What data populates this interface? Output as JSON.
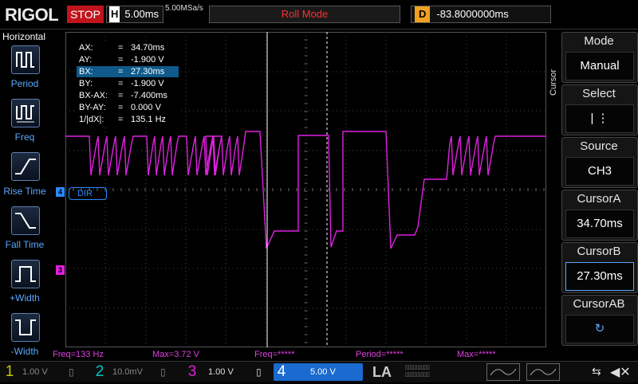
{
  "top_bar": {
    "brand": "RIGOL",
    "run_state": "STOP",
    "timebase_key": "H",
    "timebase": "5.00ms",
    "sample_rate": "5.00MSa/s",
    "mode": "Roll Mode",
    "delay_key": "D",
    "delay": "-83.8000000ms"
  },
  "left_panel": {
    "title": "Horizontal",
    "items": [
      {
        "label": "Period",
        "icon": "period-icon"
      },
      {
        "label": "Freq",
        "icon": "frequency-icon"
      },
      {
        "label": "Rise Time",
        "icon": "rise-time-icon"
      },
      {
        "label": "Fall Time",
        "icon": "fall-time-icon"
      },
      {
        "label": "+Width",
        "icon": "positive-width-icon"
      },
      {
        "label": "-Width",
        "icon": "negative-width-icon"
      }
    ]
  },
  "cursor_readout": {
    "rows": [
      {
        "key": "AX:",
        "value": "34.70ms"
      },
      {
        "key": "AY:",
        "value": "-1.900 V"
      },
      {
        "key": "BX:",
        "value": "27.30ms"
      },
      {
        "key": "BY:",
        "value": "-1.900 V"
      },
      {
        "key": "BX-AX:",
        "value": "-7.400ms"
      },
      {
        "key": "BY-AY:",
        "value": "0.000 V"
      },
      {
        "key": "1/|dX|:",
        "value": "135.1 Hz"
      }
    ],
    "selected_row": 2
  },
  "waveform": {
    "dir_label": "DIR",
    "ch4_marker": "4",
    "ch3_marker": "3",
    "color": "#e020e0"
  },
  "measurements": {
    "freq": "Freq=133 Hz",
    "max": "Max=3.72 V",
    "freq2": "Freq=*****",
    "period": "Period=*****",
    "max2": "Max=*****"
  },
  "channels": [
    {
      "num": "1",
      "value": "1.00 V",
      "color": "#c8c800"
    },
    {
      "num": "2",
      "value": "10.0mV",
      "color": "#00c8c8"
    },
    {
      "num": "3",
      "value": "1.00 V",
      "color": "#e020e0"
    },
    {
      "num": "4",
      "value": "5.00 V",
      "color": "#2a8aff"
    }
  ],
  "la_label": "LA",
  "right_panel": {
    "side_label": "Cursor",
    "mode_title": "Mode",
    "mode_value": "Manual",
    "select_title": "Select",
    "select_value": "|   ⋮",
    "source_title": "Source",
    "source_value": "CH3",
    "cursor_a_title": "CursorA",
    "cursor_a_value": "34.70ms",
    "cursor_b_title": "CursorB",
    "cursor_b_value": "27.30ms",
    "cursor_ab_title": "CursorAB"
  }
}
